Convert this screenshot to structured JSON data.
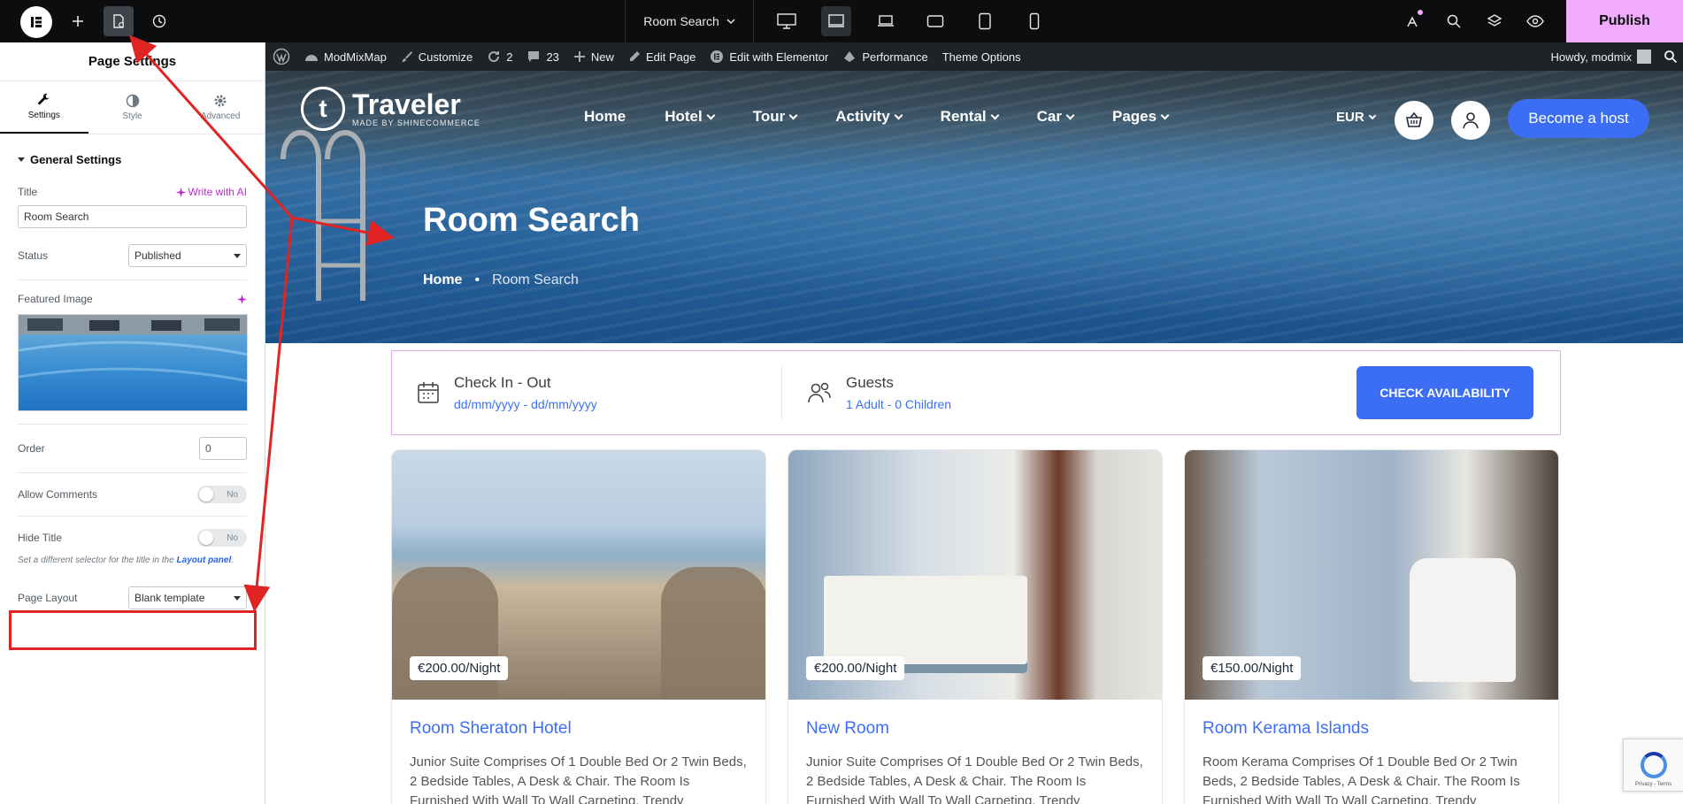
{
  "topbar": {
    "page_name": "Room Search",
    "publish_label": "Publish"
  },
  "panel": {
    "title": "Page Settings",
    "tabs": [
      {
        "label": "Settings"
      },
      {
        "label": "Style"
      },
      {
        "label": "Advanced"
      }
    ],
    "section_title": "General Settings",
    "title_label": "Title",
    "ai_label": "Write with AI",
    "title_value": "Room Search",
    "status_label": "Status",
    "status_value": "Published",
    "featured_label": "Featured Image",
    "order_label": "Order",
    "order_value": "0",
    "allow_comments_label": "Allow Comments",
    "allow_comments_value": "No",
    "hide_title_label": "Hide Title",
    "hide_title_value": "No",
    "help_text": "Set a different selector for the title in the",
    "help_link": "Layout panel",
    "page_layout_label": "Page Layout",
    "page_layout_value": "Blank template"
  },
  "wpbar": {
    "site_name": "ModMixMap",
    "customize": "Customize",
    "updates": "2",
    "comments": "23",
    "new": "New",
    "edit_page": "Edit Page",
    "edit_elementor": "Edit with Elementor",
    "performance": "Performance",
    "theme_options": "Theme Options",
    "howdy": "Howdy, modmix"
  },
  "site": {
    "logo_name": "Traveler",
    "logo_sub": "MADE BY SHINECOMMERCE",
    "nav": [
      {
        "label": "Home",
        "has_menu": false
      },
      {
        "label": "Hotel",
        "has_menu": true
      },
      {
        "label": "Tour",
        "has_menu": true
      },
      {
        "label": "Activity",
        "has_menu": true
      },
      {
        "label": "Rental",
        "has_menu": true
      },
      {
        "label": "Car",
        "has_menu": true
      },
      {
        "label": "Pages",
        "has_menu": true
      }
    ],
    "currency": "EUR",
    "host_button": "Become a host",
    "hero_title": "Room Search",
    "breadcrumb_home": "Home",
    "breadcrumb_current": "Room Search",
    "search": {
      "checkin_label": "Check In - Out",
      "checkin_value": "dd/mm/yyyy - dd/mm/yyyy",
      "guests_label": "Guests",
      "guests_value": "1 Adult - 0 Children",
      "button": "CHECK AVAILABILITY"
    },
    "cards": [
      {
        "price": "€200.00/Night",
        "title": "Room Sheraton Hotel",
        "desc": "Junior Suite Comprises Of 1 Double Bed Or 2 Twin Beds, 2 Bedside Tables, A Desk & Chair. The Room Is Furnished With Wall To Wall Carpeting, Trendy"
      },
      {
        "price": "€200.00/Night",
        "title": "New Room",
        "desc": "Junior Suite Comprises Of 1 Double Bed Or 2 Twin Beds, 2 Bedside Tables, A Desk & Chair. The Room Is Furnished With Wall To Wall Carpeting, Trendy"
      },
      {
        "price": "€150.00/Night",
        "title": "Room Kerama Islands",
        "desc": "Room Kerama Comprises Of 1 Double Bed Or 2 Twin Beds, 2 Bedside Tables, A Desk & Chair. The Room Is Furnished With Wall To Wall Carpeting, Trendy"
      }
    ],
    "recaptcha_text": "Privacy - Terms"
  },
  "colors": {
    "accent": "#3b6ef5",
    "publish": "#f0abfc",
    "annotation": "#e02424"
  }
}
